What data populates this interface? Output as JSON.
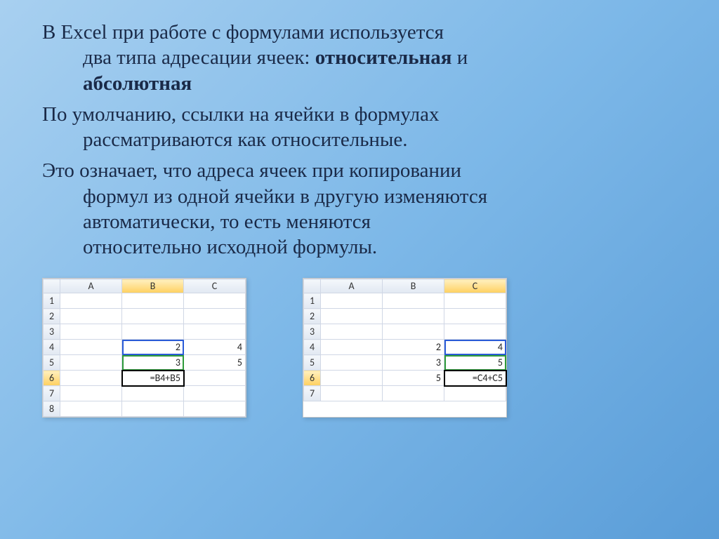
{
  "text": {
    "p1_line1": "В Excel при работе с формулами используется",
    "p1_line2a": "два типа адресации ячеек: ",
    "p1_bold1": "относительная",
    "p1_line2b": " и ",
    "p1_bold2": "абсолютная",
    "p2_line1": "По умолчанию, ссылки на ячейки в формулах",
    "p2_line2": "рассматриваются как относительные.",
    "p3_line1": "Это означает, что адреса ячеек при копировании",
    "p3_line2": "формул из одной ячейки в другую изменяются",
    "p3_line3": "автоматически, то есть меняются",
    "p3_line4": "относительно исходной формулы."
  },
  "fig1": {
    "cols": [
      "A",
      "B",
      "C"
    ],
    "rows": [
      "1",
      "2",
      "3",
      "4",
      "5",
      "6",
      "7",
      "8"
    ],
    "active_col": "B",
    "active_row": "6",
    "cells": {
      "B4": "2",
      "C4": "4",
      "B5": "3",
      "C5": "5",
      "B6": "=B4+B5"
    }
  },
  "fig2": {
    "cols": [
      "A",
      "B",
      "C"
    ],
    "rows": [
      "1",
      "2",
      "3",
      "4",
      "5",
      "6",
      "7"
    ],
    "active_col": "C",
    "active_row": "6",
    "cells": {
      "B4": "2",
      "C4": "4",
      "B5": "3",
      "C5": "5",
      "B6": "5",
      "C6": "=C4+C5"
    }
  }
}
